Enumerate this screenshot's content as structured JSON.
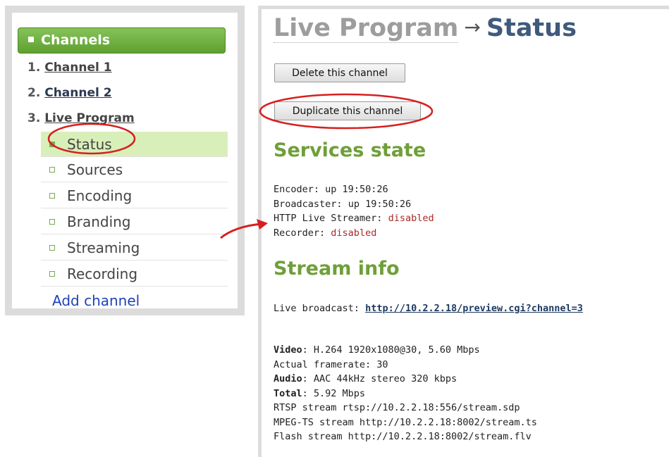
{
  "sidebar": {
    "header": "Channels",
    "channels": [
      {
        "num": "1.",
        "label": "Channel 1"
      },
      {
        "num": "2.",
        "label": "Channel 2"
      },
      {
        "num": "3.",
        "label": "Live Program"
      }
    ],
    "subitems": [
      "Status",
      "Sources",
      "Encoding",
      "Branding",
      "Streaming",
      "Recording"
    ],
    "active_subitem": "Status",
    "add_channel": "Add channel"
  },
  "header": {
    "breadcrumb": "Live Program",
    "arrow": "→",
    "current": "Status"
  },
  "buttons": {
    "delete": "Delete this channel",
    "duplicate": "Duplicate this channel"
  },
  "services": {
    "title": "Services state",
    "encoder_label": "Encoder:",
    "encoder_value": "up 19:50:26",
    "broadcaster_label": "Broadcaster:",
    "broadcaster_value": "up 19:50:26",
    "hls_label": "HTTP Live Streamer:",
    "hls_value": "disabled",
    "recorder_label": "Recorder:",
    "recorder_value": "disabled"
  },
  "stream": {
    "title": "Stream info",
    "live_label": "Live broadcast:",
    "live_url": "http://10.2.2.18/preview.cgi?channel=3",
    "video_label": "Video",
    "video_value": ": H.264 1920x1080@30, 5.60 Mbps",
    "framerate": "Actual framerate: 30",
    "audio_label": "Audio",
    "audio_value": ": AAC 44kHz stereo 320 kbps",
    "total_label": "Total",
    "total_value": ": 5.92 Mbps",
    "rtsp": "RTSP stream rtsp://10.2.2.18:556/stream.sdp",
    "mpegts": "MPEG-TS stream http://10.2.2.18:8002/stream.ts",
    "flash": "Flash stream http://10.2.2.18:8002/stream.flv"
  },
  "colors": {
    "accent_green": "#6f9f3a",
    "annotation_red": "#d62020",
    "disabled_red": "#a52a2a"
  }
}
